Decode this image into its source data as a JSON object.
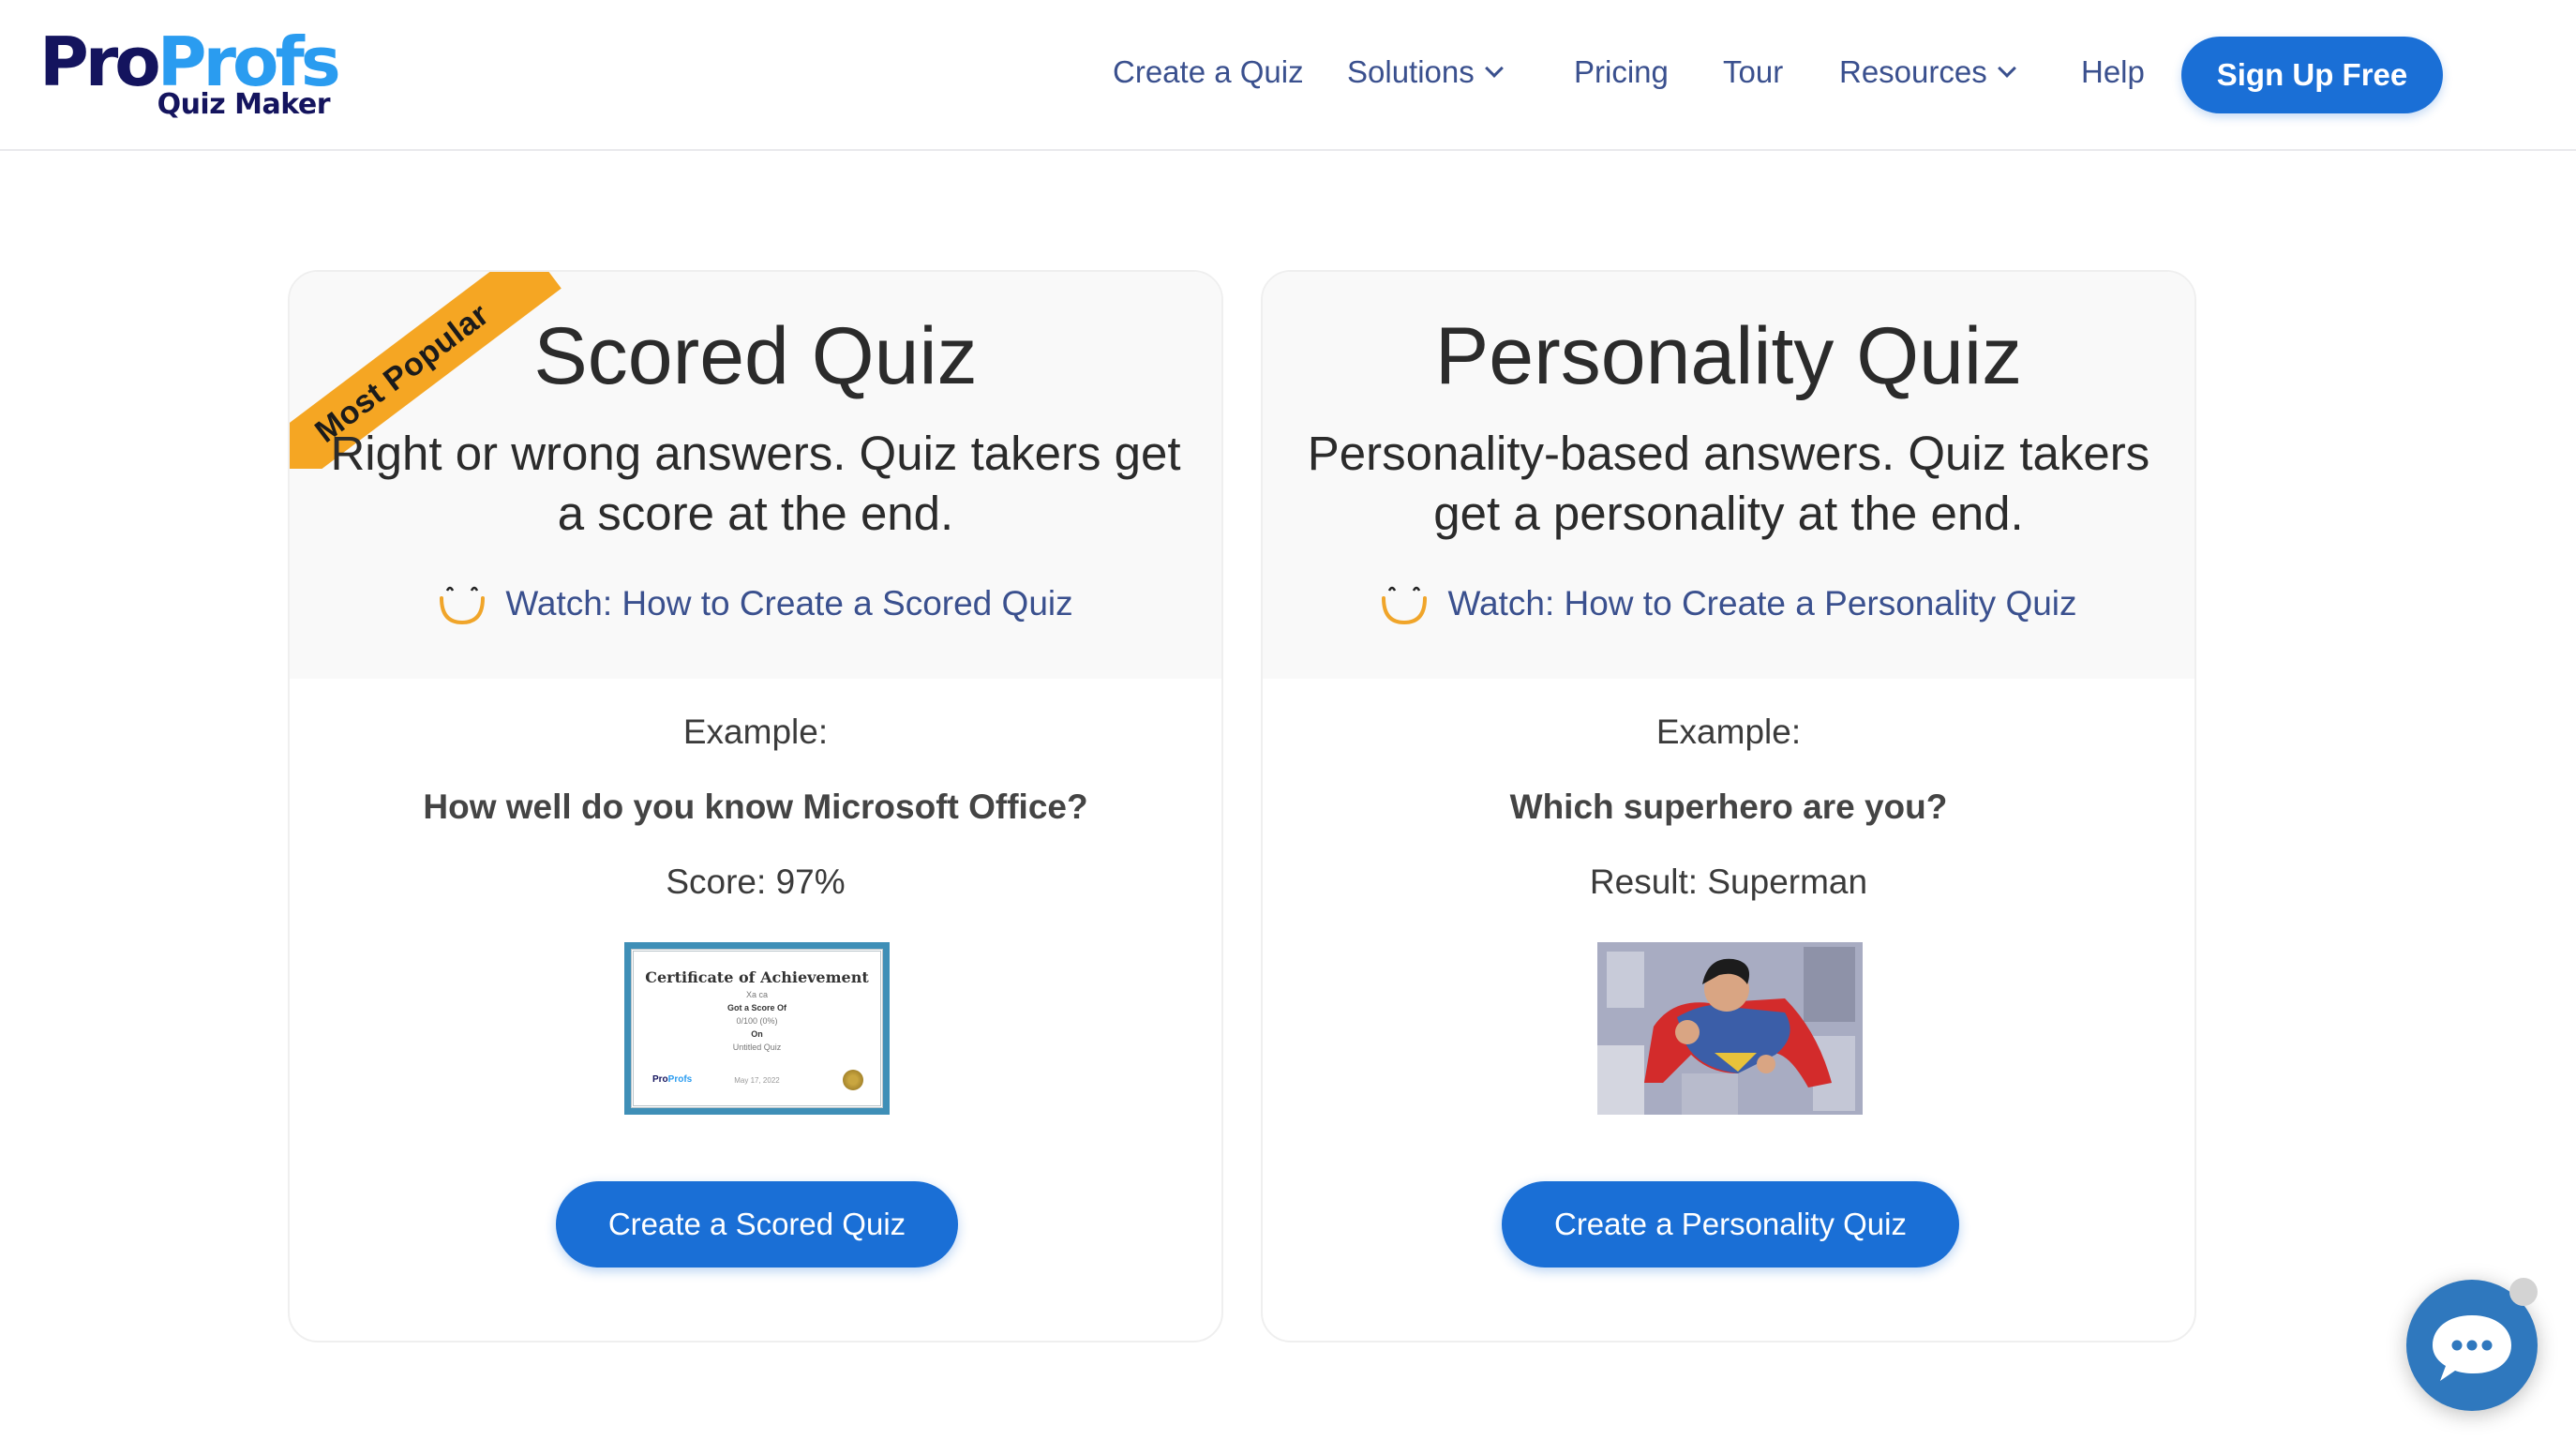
{
  "header": {
    "logo": {
      "part1": "Pro",
      "part2": "Profs",
      "subtitle": "Quiz Maker"
    },
    "nav": [
      {
        "label": "Create a Quiz",
        "dropdown": false
      },
      {
        "label": "Solutions",
        "dropdown": true
      },
      {
        "label": "Pricing",
        "dropdown": false
      },
      {
        "label": "Tour",
        "dropdown": false
      },
      {
        "label": "Resources",
        "dropdown": true
      },
      {
        "label": "Help",
        "dropdown": false
      }
    ],
    "cta": "Sign Up Free"
  },
  "cards": [
    {
      "badge": "Most Popular",
      "title": "Scored Quiz",
      "description": "Right or wrong answers. Quiz takers get a score at the end.",
      "watch_link": "Watch: How to Create a Scored Quiz",
      "example_label": "Example:",
      "example_question": "How well do you know Microsoft Office?",
      "example_result": "Score: 97%",
      "image": {
        "type": "certificate",
        "title": "Certificate of Achievement",
        "name": "Xa ca",
        "line1": "Got a Score Of",
        "line2": "0/100 (0%)",
        "line3": "On",
        "line4": "Untitled Quiz",
        "date": "May 17, 2022",
        "logo1": "Pro",
        "logo2": "Profs"
      },
      "button": "Create a Scored Quiz"
    },
    {
      "title": "Personality Quiz",
      "description": "Personality-based answers. Quiz takers get a personality at the end.",
      "watch_link": "Watch: How to Create a Personality Quiz",
      "example_label": "Example:",
      "example_question": "Which superhero are you?",
      "example_result": "Result: Superman",
      "image": {
        "type": "photo",
        "alt": "Superman flying over city"
      },
      "button": "Create a Personality Quiz"
    }
  ],
  "colors": {
    "brand_dark": "#14145e",
    "brand_light": "#2a9cf0",
    "nav_text": "#3a508e",
    "button_blue": "#1a6fd6",
    "ribbon": "#f5a623",
    "chat": "#2f78be"
  }
}
